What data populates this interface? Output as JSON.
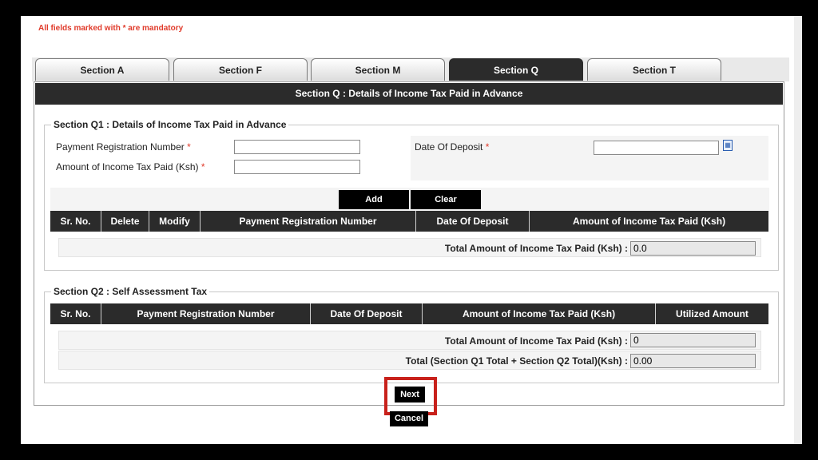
{
  "mandatory_note": "All fields marked with * are mandatory",
  "tabs": [
    {
      "label": "Section A",
      "active": false
    },
    {
      "label": "Section F",
      "active": false
    },
    {
      "label": "Section M",
      "active": false
    },
    {
      "label": "Section Q",
      "active": true
    },
    {
      "label": "Section T",
      "active": false
    }
  ],
  "panel_title": "Section Q : Details of Income Tax Paid in Advance",
  "q1": {
    "legend": "Section Q1 : Details of Income Tax Paid in Advance",
    "prn_label": "Payment Registration Number",
    "amount_label": "Amount of Income Tax Paid (Ksh)",
    "date_label": "Date Of Deposit",
    "required_mark": "*",
    "prn_value": "",
    "amount_value": "",
    "date_value": "",
    "add_label": "Add",
    "clear_label": "Clear",
    "columns": [
      "Sr. No.",
      "Delete",
      "Modify",
      "Payment Registration Number",
      "Date Of Deposit",
      "Amount of Income Tax Paid (Ksh)"
    ],
    "total_label": "Total Amount of Income Tax Paid (Ksh) :",
    "total_value": "0.0"
  },
  "q2": {
    "legend": "Section Q2 : Self Assessment Tax",
    "columns": [
      "Sr. No.",
      "Payment Registration Number",
      "Date Of Deposit",
      "Amount of Income Tax Paid (Ksh)",
      "Utilized Amount"
    ],
    "total_label": "Total Amount of Income Tax Paid (Ksh) :",
    "total_value": "0",
    "grand_total_label": "Total (Section Q1 Total + Section Q2 Total)(Ksh) :",
    "grand_total_value": "0.00"
  },
  "next_label": "Next",
  "cancel_label": "Cancel",
  "calendar_icon": "calendar-icon",
  "colors": {
    "accent_red": "#e03a2a",
    "header_dark": "#2b2b2b",
    "highlight": "#c8211b"
  }
}
